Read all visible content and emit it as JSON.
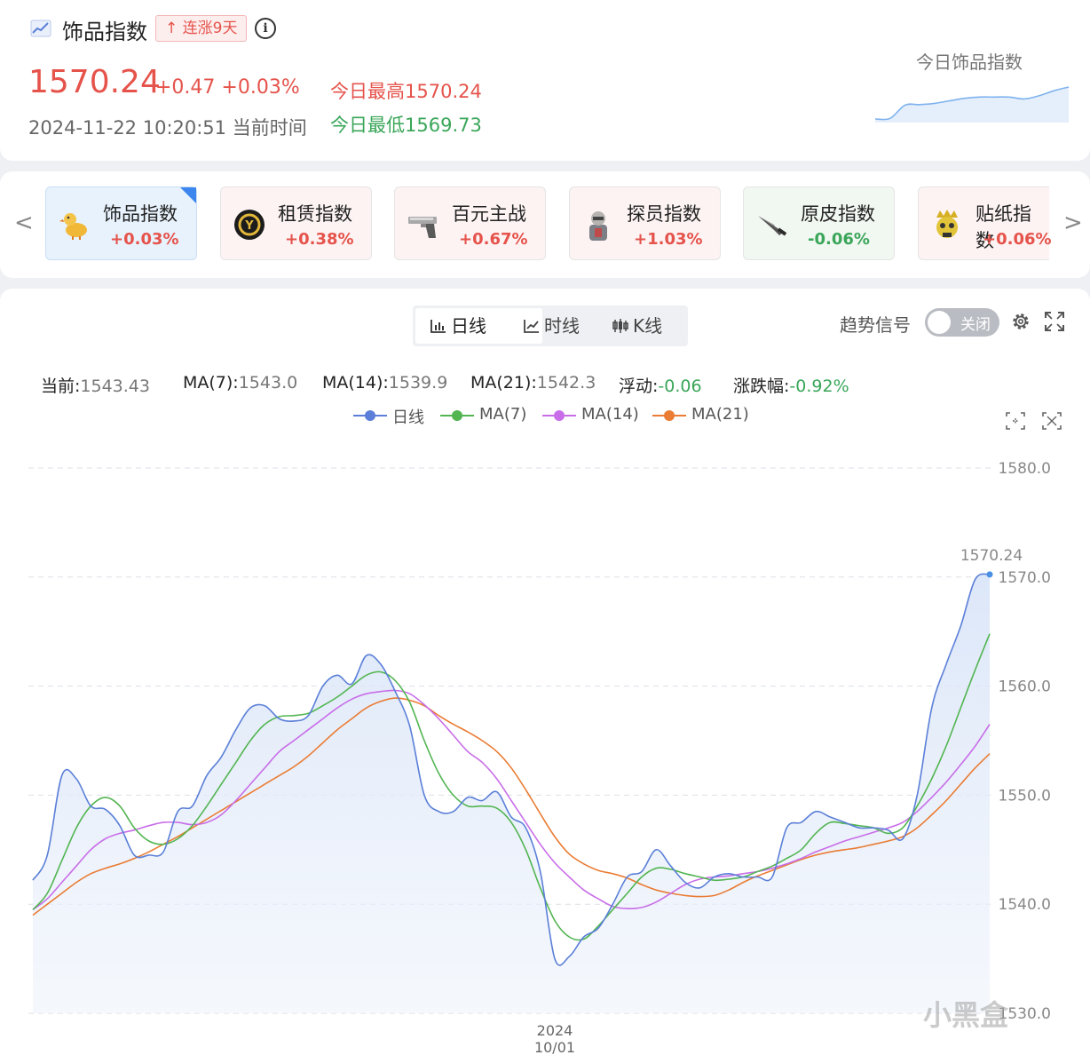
{
  "header": {
    "title": "饰品指数",
    "streak_badge": "↑ 连涨9天",
    "info_icon": "info-circle-icon",
    "price": "1570.24",
    "change": "+0.47 +0.03%",
    "timestamp": "2024-11-22 10:20:51 当前时间",
    "today_high": "今日最高1570.24",
    "today_low": "今日最低1569.73",
    "mini_chart_label": "今日饰品指数",
    "mini_chart_values": [
      1569.73,
      1569.74,
      1569.95,
      1569.96,
      1569.98,
      1570.02,
      1570.06,
      1570.08,
      1570.08,
      1570.08,
      1570.05,
      1570.1,
      1570.18,
      1570.24
    ],
    "colors": {
      "up": "#e5534b",
      "down": "#3aa659",
      "accent": "#3c86ee"
    }
  },
  "tabs": [
    {
      "name": "饰品指数",
      "change": "+0.03%",
      "dir": "up",
      "active": true,
      "icon": "duck-icon"
    },
    {
      "name": "租赁指数",
      "change": "+0.38%",
      "dir": "up",
      "active": false,
      "icon": "lease-coin-icon"
    },
    {
      "name": "百元主战",
      "change": "+0.67%",
      "dir": "up",
      "active": false,
      "icon": "pistol-icon"
    },
    {
      "name": "探员指数",
      "change": "+1.03%",
      "dir": "up",
      "active": false,
      "icon": "agent-icon"
    },
    {
      "name": "原皮指数",
      "change": "-0.06%",
      "dir": "down",
      "active": false,
      "icon": "knife-icon"
    },
    {
      "name": "贴纸指数",
      "change": "+0.06%",
      "dir": "up",
      "active": false,
      "icon": "sticker-skull-icon"
    }
  ],
  "tab_nav": {
    "prev": "<",
    "next": ">"
  },
  "controls": {
    "segments": [
      "日线",
      "时线",
      "K线"
    ],
    "active_segment": "日线",
    "trend_label": "趋势信号",
    "toggle_label": "关闭"
  },
  "stats": [
    {
      "key": "当前:",
      "value": "1543.43",
      "color": "#777"
    },
    {
      "key": "MA(7):",
      "value": "1543.0",
      "color": "#777"
    },
    {
      "key": "MA(14):",
      "value": "1539.9",
      "color": "#777"
    },
    {
      "key": "MA(21):",
      "value": "1542.3",
      "color": "#777"
    },
    {
      "key": "浮动:",
      "value": "-0.06",
      "color": "#3aa659"
    },
    {
      "key": "涨跌幅:",
      "value": "-0.92%",
      "color": "#3aa659"
    }
  ],
  "chart_data": {
    "type": "line",
    "ylim": [
      1530,
      1580
    ],
    "yticks": [
      "1580.0",
      "1570.0",
      "1560.0",
      "1550.0",
      "1540.0",
      "1530.0"
    ],
    "x_label_lines": [
      "2024",
      "10/01"
    ],
    "x_label_index": 36,
    "last_value_label": "1570.24",
    "grid": true,
    "legend_position": "top-center",
    "series": [
      {
        "name": "日线",
        "color": "#5b7fd8",
        "area": true,
        "values": [
          1542.2,
          1544.5,
          1551.8,
          1551.5,
          1549.0,
          1548.7,
          1547.2,
          1544.5,
          1544.5,
          1544.8,
          1548.5,
          1549.0,
          1551.8,
          1553.5,
          1556.0,
          1558.0,
          1558.2,
          1557.0,
          1556.8,
          1557.3,
          1560.0,
          1561.0,
          1560.2,
          1562.8,
          1562.0,
          1559.5,
          1556.3,
          1550.0,
          1548.5,
          1548.5,
          1549.8,
          1549.5,
          1550.3,
          1548.0,
          1547.0,
          1543.0,
          1535.0,
          1535.2,
          1537.0,
          1537.8,
          1540.0,
          1542.5,
          1543.0,
          1545.0,
          1543.5,
          1542.0,
          1541.5,
          1542.5,
          1542.8,
          1542.5,
          1542.5,
          1542.5,
          1547.0,
          1547.5,
          1548.5,
          1548.0,
          1547.5,
          1547.0,
          1547.0,
          1546.8,
          1546.0,
          1550.0,
          1558.0,
          1562.0,
          1565.5,
          1569.8,
          1570.24
        ]
      },
      {
        "name": "MA(7)",
        "color": "#52b551",
        "values": [
          1539.5,
          1541.0,
          1544.0,
          1547.0,
          1549.0,
          1549.8,
          1549.0,
          1547.0,
          1545.8,
          1545.5,
          1546.0,
          1547.2,
          1549.0,
          1551.0,
          1553.0,
          1555.0,
          1556.5,
          1557.2,
          1557.3,
          1557.5,
          1558.2,
          1559.0,
          1560.0,
          1561.0,
          1561.3,
          1560.5,
          1558.5,
          1555.0,
          1552.0,
          1550.0,
          1549.0,
          1549.0,
          1548.8,
          1547.5,
          1545.0,
          1541.5,
          1538.5,
          1537.0,
          1536.8,
          1538.0,
          1539.5,
          1541.0,
          1542.5,
          1543.3,
          1543.2,
          1542.8,
          1542.5,
          1542.2,
          1542.3,
          1542.5,
          1543.0,
          1543.5,
          1544.2,
          1545.0,
          1546.5,
          1547.5,
          1547.4,
          1547.2,
          1547.0,
          1546.5,
          1547.0,
          1549.0,
          1551.5,
          1554.5,
          1558.0,
          1561.5,
          1564.8
        ]
      },
      {
        "name": "MA(14)",
        "color": "#c86ee8",
        "values": [
          1539.5,
          1540.5,
          1542.0,
          1543.5,
          1545.0,
          1546.0,
          1546.5,
          1546.8,
          1547.2,
          1547.5,
          1547.5,
          1547.3,
          1547.5,
          1548.2,
          1549.5,
          1551.0,
          1552.5,
          1554.0,
          1555.0,
          1556.0,
          1557.0,
          1558.0,
          1558.8,
          1559.3,
          1559.5,
          1559.6,
          1559.3,
          1558.3,
          1557.0,
          1555.5,
          1554.0,
          1553.0,
          1551.5,
          1549.5,
          1547.5,
          1545.5,
          1543.8,
          1542.5,
          1541.3,
          1540.5,
          1539.8,
          1539.6,
          1539.7,
          1540.2,
          1541.0,
          1541.8,
          1542.3,
          1542.5,
          1542.6,
          1542.8,
          1543.0,
          1543.3,
          1543.7,
          1544.2,
          1544.8,
          1545.3,
          1545.8,
          1546.2,
          1546.6,
          1547.0,
          1547.5,
          1548.5,
          1549.8,
          1551.2,
          1552.8,
          1554.5,
          1556.5
        ]
      },
      {
        "name": "MA(21)",
        "color": "#ea7c34",
        "values": [
          1539.0,
          1540.0,
          1541.0,
          1542.0,
          1542.8,
          1543.3,
          1543.7,
          1544.2,
          1544.8,
          1545.5,
          1546.2,
          1547.0,
          1547.8,
          1548.6,
          1549.4,
          1550.2,
          1551.0,
          1551.8,
          1552.6,
          1553.6,
          1554.8,
          1556.0,
          1557.0,
          1558.0,
          1558.6,
          1558.9,
          1558.7,
          1558.2,
          1557.3,
          1556.5,
          1555.8,
          1555.0,
          1554.0,
          1552.5,
          1550.5,
          1548.3,
          1546.2,
          1544.6,
          1543.7,
          1543.1,
          1542.8,
          1542.4,
          1541.8,
          1541.3,
          1541.0,
          1540.8,
          1540.7,
          1540.8,
          1541.3,
          1542.0,
          1542.6,
          1543.1,
          1543.6,
          1544.1,
          1544.5,
          1544.8,
          1545.0,
          1545.2,
          1545.5,
          1545.8,
          1546.2,
          1547.0,
          1548.2,
          1549.5,
          1551.0,
          1552.5,
          1553.8
        ]
      }
    ]
  },
  "watermark": "小黑盒"
}
